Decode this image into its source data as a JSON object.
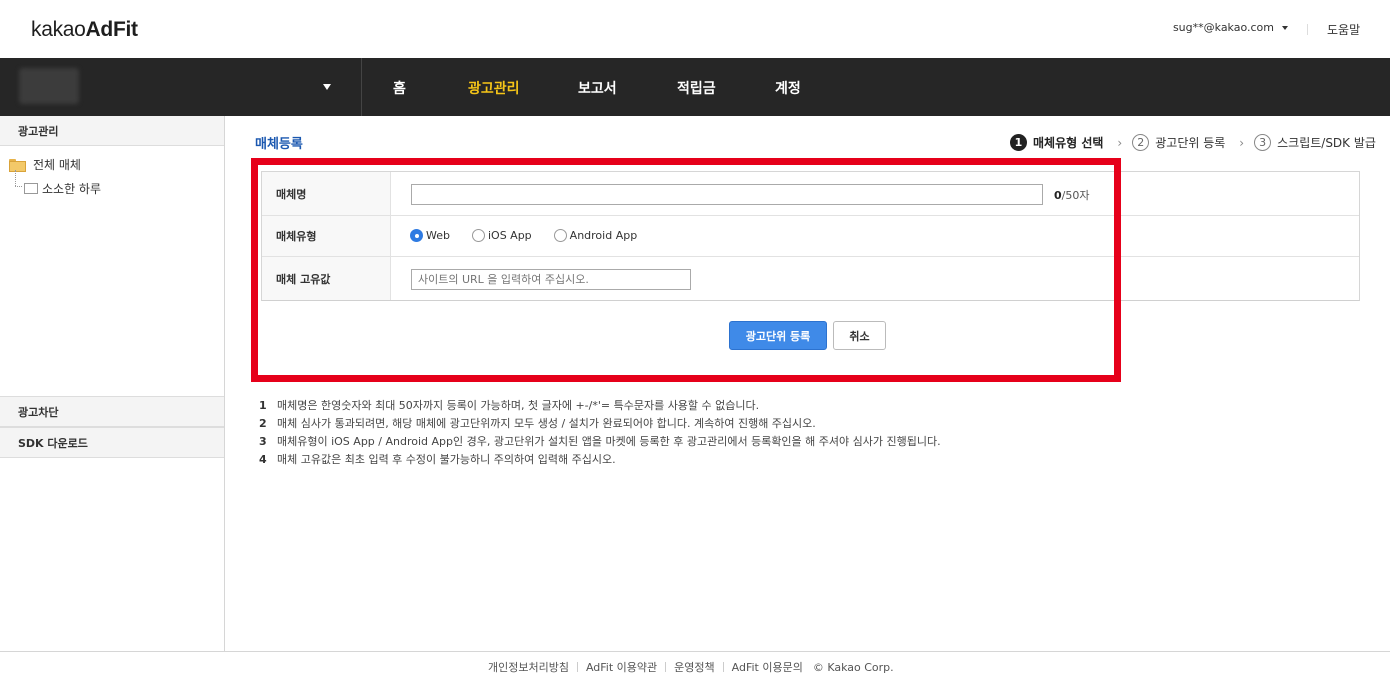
{
  "header": {
    "logo_light": "kakao",
    "logo_bold": "AdFit",
    "account_email": "sug**@kakao.com",
    "help_label": "도움말"
  },
  "nav": {
    "items": [
      {
        "label": "홈",
        "active": false
      },
      {
        "label": "광고관리",
        "active": true
      },
      {
        "label": "보고서",
        "active": false
      },
      {
        "label": "적립금",
        "active": false
      },
      {
        "label": "계정",
        "active": false
      }
    ],
    "active_color": "#f5c518",
    "bar_color": "#262626"
  },
  "sidebar": {
    "section_title": "광고관리",
    "tree": {
      "root_label": "전체 매체",
      "child_label": "소소한 하루"
    },
    "blocking_label": "광고차단",
    "sdk_label": "SDK 다운로드"
  },
  "main": {
    "page_title": "매체등록",
    "steps": [
      {
        "num": "1",
        "label": "매체유형 선택",
        "active": true
      },
      {
        "num": "2",
        "label": "광고단위 등록",
        "active": false
      },
      {
        "num": "3",
        "label": "스크립트/SDK 발급",
        "active": false
      }
    ],
    "form": {
      "name_label": "매체명",
      "name_value": "",
      "name_counter_current": "0",
      "name_counter_max": "/50자",
      "type_label": "매체유형",
      "type_options": [
        {
          "label": "Web",
          "selected": true
        },
        {
          "label": "iOS App",
          "selected": false
        },
        {
          "label": "Android App",
          "selected": false
        }
      ],
      "unique_label": "매체 고유값",
      "unique_placeholder": "사이트의 URL 을 입력하여 주십시오."
    },
    "buttons": {
      "submit_label": "광고단위 등록",
      "cancel_label": "취소"
    },
    "notes": [
      {
        "num": "1",
        "text": "매체명은 한영숫자와 최대 50자까지 등록이 가능하며, 첫 글자에 +-/*'= 특수문자를 사용할 수 없습니다."
      },
      {
        "num": "2",
        "text": "매체 심사가 통과되려면, 해당 매체에 광고단위까지 모두 생성 / 설치가 완료되어야 합니다. 계속하여 진행해 주십시오."
      },
      {
        "num": "3",
        "text": "매체유형이 iOS App / Android App인 경우, 광고단위가 설치된 앱을 마켓에 등록한 후 광고관리에서 등록확인을 해 주셔야 심사가 진행됩니다."
      },
      {
        "num": "4",
        "text": "매체 고유값은 최초 입력 후 수정이 불가능하니 주의하여 입력해 주십시오."
      }
    ],
    "accent_color": "#3f8ae8",
    "highlight_color": "#e6001a"
  },
  "footer": {
    "links": [
      "개인정보처리방침",
      "AdFit 이용약관",
      "운영정책",
      "AdFit 이용문의"
    ],
    "copyright": "© Kakao Corp."
  }
}
